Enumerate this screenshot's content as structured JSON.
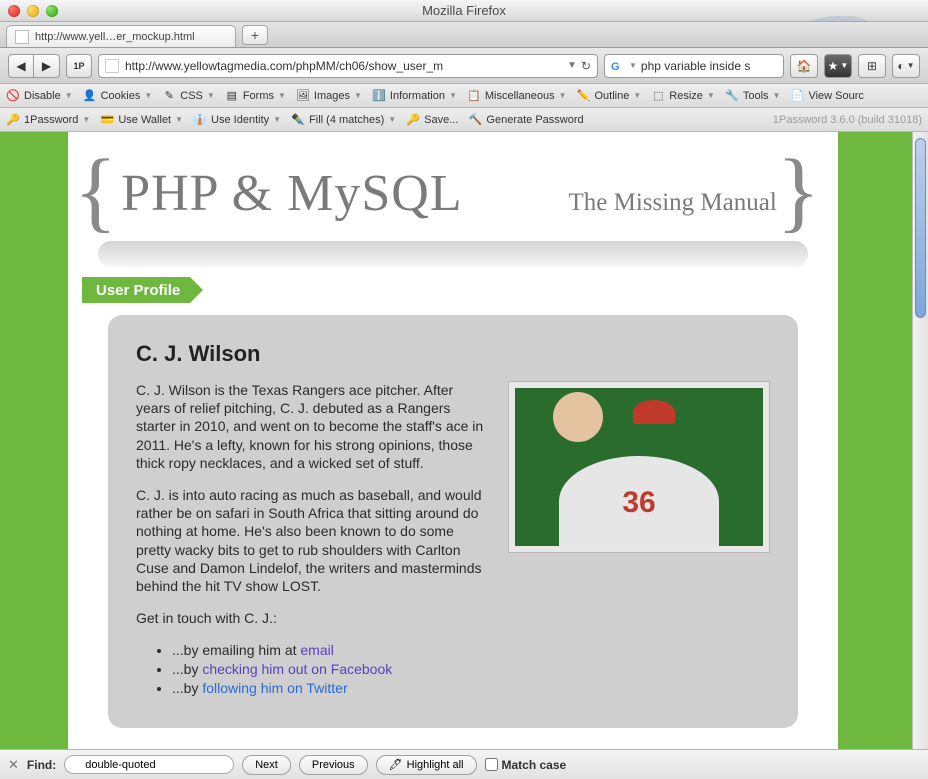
{
  "window": {
    "title": "Mozilla Firefox"
  },
  "tab": {
    "label": "http://www.yell…er_mockup.html"
  },
  "url": {
    "value": "http://www.yellowtagmedia.com/phpMM/ch06/show_user_m"
  },
  "search": {
    "value": "php variable inside s"
  },
  "devtoolbar1": {
    "disable": "Disable",
    "cookies": "Cookies",
    "css": "CSS",
    "forms": "Forms",
    "images": "Images",
    "information": "Information",
    "miscellaneous": "Miscellaneous",
    "outline": "Outline",
    "resize": "Resize",
    "tools": "Tools",
    "viewsource": "View Sourc"
  },
  "devtoolbar2": {
    "onepassword": "1Password",
    "usewallet": "Use Wallet",
    "useidentity": "Use Identity",
    "fill": "Fill (4 matches)",
    "save": "Save...",
    "generate": "Generate Password",
    "watermark": "1Password 3.6.0 (build 31018)"
  },
  "page": {
    "title_main": "PHP & MySQL",
    "title_sub": "The Missing Manual",
    "section_tab": "User Profile",
    "profile": {
      "name": "C. J. Wilson",
      "jersey_number": "36",
      "p1": "C. J. Wilson is the Texas Rangers ace pitcher. After years of relief pitching, C. J. debuted as a Rangers starter in 2010, and went on to become the staff's ace in 2011. He's a lefty, known for his strong opinions, those thick ropy necklaces, and a wicked set of stuff.",
      "p2": "C. J. is into auto racing as much as baseball, and would rather be on safari in South Africa that sitting around do nothing at home. He's also been known to do some pretty wacky bits to get to rub shoulders with Carlton Cuse and Damon Lindelof, the writers and masterminds behind the hit TV show LOST.",
      "p3": "Get in touch with C. J.:",
      "contacts": {
        "email_pre": "...by emailing him at ",
        "email_link": "email",
        "fb_pre": "...by ",
        "fb_link": "checking him out on Facebook",
        "tw_pre": "...by ",
        "tw_link": "following him on Twitter"
      }
    }
  },
  "findbar": {
    "label": "Find:",
    "value": "double-quoted",
    "next": "Next",
    "previous": "Previous",
    "highlight": "Highlight all",
    "matchcase": "Match case"
  }
}
